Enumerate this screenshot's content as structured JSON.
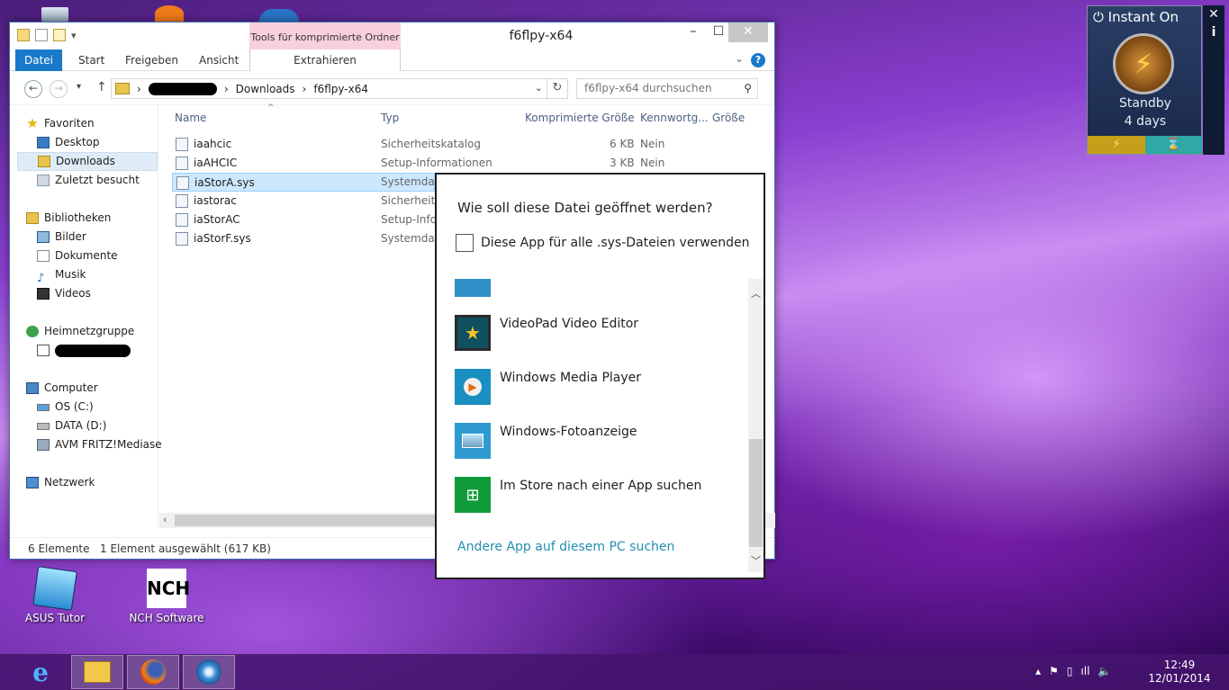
{
  "desktop": {
    "icons": [
      {
        "label": "ASUS Tutor"
      },
      {
        "label": "NCH Software"
      }
    ],
    "nch_logo_text": "NCH"
  },
  "explorer": {
    "title": "f6flpy-x64",
    "context_tab_header": "Tools für komprimierte Ordner",
    "ribbon_tabs": [
      "Datei",
      "Start",
      "Freigeben",
      "Ansicht",
      "Extrahieren"
    ],
    "help": "?",
    "address": {
      "segments": [
        "Downloads",
        "f6flpy-x64"
      ]
    },
    "search_placeholder": "f6flpy-x64 durchsuchen",
    "nav": {
      "favorites": "Favoriten",
      "desktop": "Desktop",
      "downloads": "Downloads",
      "recent": "Zuletzt besucht",
      "libraries": "Bibliotheken",
      "pictures": "Bilder",
      "documents": "Dokumente",
      "music": "Musik",
      "videos": "Videos",
      "homegroup": "Heimnetzgruppe",
      "computer": "Computer",
      "os": "OS (C:)",
      "data": "DATA (D:)",
      "fritz": "AVM FRITZ!Mediase",
      "network": "Netzwerk"
    },
    "columns": [
      "Name",
      "Typ",
      "Komprimierte Größe",
      "Kennwortg...",
      "Größe"
    ],
    "files": [
      {
        "name": "iaahcic",
        "type": "Sicherheitskatalog",
        "csize": "6 KB",
        "pw": "Nein"
      },
      {
        "name": "iaAHCIC",
        "type": "Setup-Informationen",
        "csize": "3 KB",
        "pw": "Nein"
      },
      {
        "name": "iaStorA.sys",
        "type": "Systemdate",
        "csize": "",
        "pw": ""
      },
      {
        "name": "iastorac",
        "type": "Sicherheitsk",
        "csize": "",
        "pw": ""
      },
      {
        "name": "iaStorAC",
        "type": "Setup-Infor",
        "csize": "",
        "pw": ""
      },
      {
        "name": "iaStorF.sys",
        "type": "Systemdate",
        "csize": "",
        "pw": ""
      }
    ],
    "status": {
      "count": "6 Elemente",
      "selection": "1 Element ausgewählt (617 KB)"
    }
  },
  "open_with": {
    "question": "Wie soll diese Datei geöffnet werden?",
    "always_use_label": "Diese App für alle .sys-Dateien verwenden",
    "always_use_checked": false,
    "apps": [
      {
        "label": "VideoPad Video Editor",
        "icon": "videopad-icon"
      },
      {
        "label": "Windows Media Player",
        "icon": "media-player-icon"
      },
      {
        "label": "Windows-Fotoanzeige",
        "icon": "photo-viewer-icon"
      },
      {
        "label": "Im Store nach einer App suchen",
        "icon": "store-icon"
      }
    ],
    "more_link": "Andere App auf diesem PC suchen"
  },
  "instant_on": {
    "title": "Instant On",
    "state": "Standby",
    "duration": "4 days",
    "close": "✕",
    "info": "i"
  },
  "taskbar": {
    "time": "12:49",
    "date": "12/01/2014"
  }
}
